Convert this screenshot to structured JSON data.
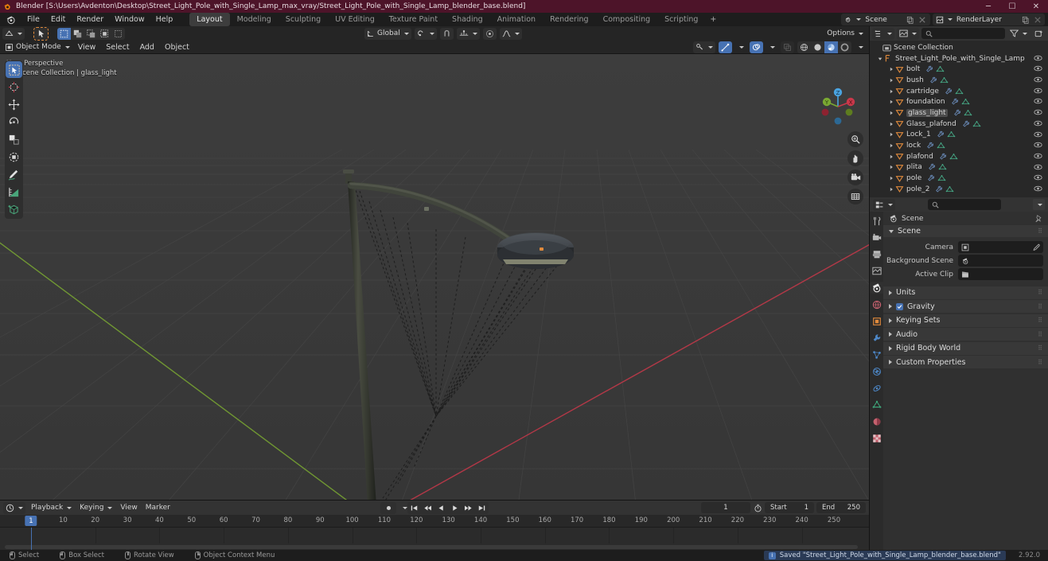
{
  "window": {
    "title": "Blender [S:\\Users\\Avdenton\\Desktop\\Street_Light_Pole_with_Single_Lamp_max_vray/Street_Light_Pole_with_Single_Lamp_blender_base.blend]",
    "minimize": "─",
    "maximize": "☐",
    "close": "✕"
  },
  "menubar": {
    "items": [
      "File",
      "Edit",
      "Render",
      "Window",
      "Help"
    ]
  },
  "workspaces": {
    "tabs": [
      "Layout",
      "Modeling",
      "Sculpting",
      "UV Editing",
      "Texture Paint",
      "Shading",
      "Animation",
      "Rendering",
      "Compositing",
      "Scripting"
    ],
    "active": "Layout",
    "add_label": "+"
  },
  "topbar_right": {
    "scene_name": "Scene",
    "viewlayer_name": "RenderLayer"
  },
  "viewport": {
    "mode": "Object Mode",
    "menus": [
      "View",
      "Select",
      "Add",
      "Object"
    ],
    "transform_orientation": "Global",
    "options_label": "Options",
    "overlay_line1": "User Perspective",
    "overlay_line2": "(1) Scene Collection | glass_light",
    "gizmo_axes": [
      "X",
      "Y",
      "Z"
    ],
    "tools": [
      "select-box-tool",
      "cursor-tool",
      "move-tool",
      "rotate-tool",
      "scale-tool",
      "transform-tool",
      "annotate-tool",
      "measure-tool",
      "add-cube-tool"
    ],
    "nav_buttons": [
      "zoom-view",
      "pan-view",
      "camera-view",
      "toggle-ortho"
    ]
  },
  "outliner": {
    "search_placeholder": "",
    "root": "Scene Collection",
    "collection": "Street_Light_Pole_with_Single_Lamp",
    "objects": [
      {
        "name": "bolt"
      },
      {
        "name": "bush"
      },
      {
        "name": "cartridge"
      },
      {
        "name": "foundation"
      },
      {
        "name": "glass_light",
        "selected": true
      },
      {
        "name": "Glass_plafond"
      },
      {
        "name": "Lock_1"
      },
      {
        "name": "lock"
      },
      {
        "name": "plafond"
      },
      {
        "name": "plita"
      },
      {
        "name": "pole"
      },
      {
        "name": "pole_2"
      }
    ]
  },
  "properties": {
    "search_placeholder": "",
    "breadcrumb": "Scene",
    "scene_panel": "Scene",
    "fields": [
      {
        "label": "Camera",
        "value": "",
        "icon": "camera-icon"
      },
      {
        "label": "Background Scene",
        "value": "",
        "icon": "scene-icon"
      },
      {
        "label": "Active Clip",
        "value": "",
        "icon": "clip-icon"
      }
    ],
    "panels": [
      {
        "label": "Units",
        "checkbox": false
      },
      {
        "label": "Gravity",
        "checkbox": true
      },
      {
        "label": "Keying Sets",
        "checkbox": false
      },
      {
        "label": "Audio",
        "checkbox": false
      },
      {
        "label": "Rigid Body World",
        "checkbox": false
      },
      {
        "label": "Custom Properties",
        "checkbox": false
      }
    ],
    "tabs": [
      "tool-tab",
      "render-tab",
      "output-tab",
      "view-layer-tab",
      "scene-tab",
      "world-tab",
      "object-tab",
      "modifier-tab",
      "particles-tab",
      "physics-tab",
      "constraints-tab",
      "data-tab",
      "material-tab",
      "texture-tab"
    ],
    "active_tab": "scene-tab"
  },
  "timeline": {
    "menus": [
      "Playback",
      "Keying",
      "View",
      "Marker"
    ],
    "current_frame": "1",
    "start_label": "Start",
    "start_value": "1",
    "end_label": "End",
    "end_value": "250",
    "ruler_ticks": [
      "1",
      "10",
      "20",
      "30",
      "40",
      "50",
      "60",
      "70",
      "80",
      "90",
      "100",
      "110",
      "120",
      "130",
      "140",
      "150",
      "160",
      "170",
      "180",
      "190",
      "200",
      "210",
      "220",
      "230",
      "240",
      "250"
    ],
    "playback_buttons": [
      "jump-start",
      "prev-keyframe",
      "play-reverse",
      "play",
      "next-keyframe",
      "jump-end"
    ]
  },
  "statusbar": {
    "hints": [
      {
        "mouse": "l",
        "label": "Select"
      },
      {
        "mouse": "l",
        "label": "Box Select"
      },
      {
        "mouse": "m",
        "label": "Rotate View"
      },
      {
        "mouse": "r",
        "label": "Object Context Menu"
      }
    ],
    "saved_message": "Saved \"Street_Light_Pole_with_Single_Lamp_blender_base.blend\"",
    "version": "2.92.0"
  },
  "colors": {
    "accent_blue": "#4772b3",
    "title_bar": "#4d1429",
    "outliner_orange": "#e08a3c",
    "mesh_green": "#4cae8a",
    "axis_x": "#c9384a",
    "axis_y": "#7aa832"
  }
}
